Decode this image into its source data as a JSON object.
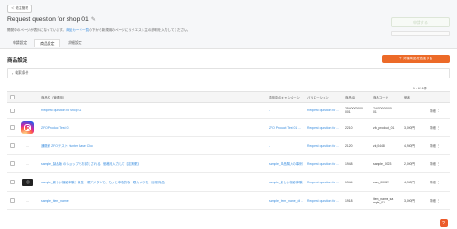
{
  "topbar": {
    "back_label": "＜ 発注管理"
  },
  "header": {
    "title": "Request question for shop 01",
    "notice_prefix": "開発中のページが表示になっています。",
    "notice_link": "商品カード一覧",
    "notice_suffix": "の下から新規用のページにリクエスト主の説明を入力してください。",
    "submit_label": "申請する"
  },
  "tabs": [
    {
      "label": "申請設定"
    },
    {
      "label": "商品設定"
    },
    {
      "label": "詳細設定"
    }
  ],
  "section": {
    "title": "商品設定",
    "add_button": "＋ 対象商品を追加する",
    "filter_label": "検索条件"
  },
  "pager": {
    "text": "1 - 6 / 6件"
  },
  "table": {
    "headers": {
      "name": "商品名（管理用）",
      "campaign": "適用中のキャンペーン",
      "variation": "バリエーション",
      "price": "商品ID",
      "code": "商品コード",
      "stock": "価格"
    },
    "rows": [
      {
        "thumb": "none",
        "name": "Request question for shop 01",
        "campaign": "-",
        "variation": "Request question for ...",
        "price": "2540000000\n001",
        "code": "74070000000\n01",
        "stock": "",
        "action": "詳細"
      },
      {
        "thumb": "instagram",
        "name": "ZFO Product Test 01",
        "campaign": "ZFO Product Test 01 ...",
        "variation": "Request question for ...",
        "price": "2210",
        "code": "zfo_product_01",
        "stock": "3,000円",
        "action": "詳細"
      },
      {
        "thumb": "dash",
        "name": "通販家 ZFO テスト Hunter Base Cloo",
        "campaign": "-",
        "variation": "Request question for ...",
        "price": "2120",
        "code": "zk_0448",
        "stock": "4,980円",
        "action": "詳細"
      },
      {
        "thumb": "dash",
        "name": "sample_製品版 のショップをお試しされる。価格を入力して【定期便】",
        "campaign": "sample_単品購入の事例",
        "variation": "Request question for ...",
        "price": "1948",
        "code": "sample_0023",
        "stock": "2,000円",
        "action": "詳細"
      },
      {
        "thumb": "camera",
        "name": "sample_新しい撮影体験！新生一眼デジタルで、もっと本格的な一眼カメラを（通常商品）",
        "campaign": "sample_新しい撮影体験",
        "variation": "Request question for ...",
        "price": "1944",
        "code": "cam_00022",
        "stock": "4,980円",
        "action": "詳細"
      },
      {
        "thumb": "dash",
        "name": "sample_item_name",
        "campaign": "sample_item_name_di ...",
        "variation": "Request question for ...",
        "price": "1918",
        "code": "item_name_sa\nmple_01",
        "stock": "3,000円",
        "action": "詳細"
      }
    ]
  },
  "colors": {
    "accent": "#ec6a28",
    "link": "#3a8dde"
  }
}
